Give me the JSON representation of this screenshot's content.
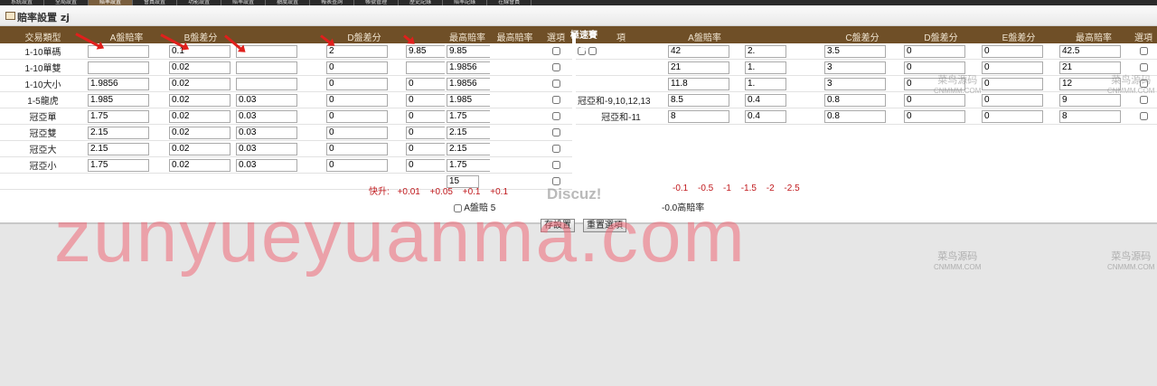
{
  "topnav": {
    "tabs": [
      "系統設置",
      "全局設置",
      "賠率設置",
      "會員設置",
      "功能設置",
      "賠率設置",
      "額度設置",
      "報表查詢",
      "帳號管理",
      "歷史記錄",
      "賠率記錄",
      "在線會員"
    ]
  },
  "panel": {
    "title": "賠率設置 zj",
    "right_section_title": "極速賽車"
  },
  "left_table": {
    "headers": [
      "交易類型",
      "A盤賠率",
      "B盤差分",
      "",
      "D盤差分",
      "",
      "最高賠率",
      "最高賠率",
      "選項"
    ],
    "rows": [
      {
        "label": "1-10單碼",
        "a": "",
        "b": "0.1",
        "c": "",
        "d": "2",
        "e": "9.85",
        "f": "9.85"
      },
      {
        "label": "1-10單雙",
        "a": "",
        "b": "0.02",
        "c": "",
        "d": "0",
        "e": "",
        "f": "1.9856"
      },
      {
        "label": "1-10大小",
        "a": "1.9856",
        "b": "0.02",
        "c": "",
        "d": "0",
        "e": "0",
        "f": "1.9856"
      },
      {
        "label": "1-5龍虎",
        "a": "1.985",
        "b": "0.02",
        "c": "0.03",
        "d": "0",
        "e": "0",
        "f": "1.985"
      },
      {
        "label": "冠亞單",
        "a": "1.75",
        "b": "0.02",
        "c": "0.03",
        "d": "0",
        "e": "0",
        "f": "1.75"
      },
      {
        "label": "冠亞雙",
        "a": "2.15",
        "b": "0.02",
        "c": "0.03",
        "d": "0",
        "e": "0",
        "f": "2.15"
      },
      {
        "label": "冠亞大",
        "a": "2.15",
        "b": "0.02",
        "c": "0.03",
        "d": "0",
        "e": "0",
        "f": "2.15"
      },
      {
        "label": "冠亞小",
        "a": "1.75",
        "b": "0.02",
        "c": "0.03",
        "d": "0",
        "e": "0",
        "f": "1.75"
      }
    ],
    "extra_value": "15"
  },
  "right_table": {
    "headers": [
      "項",
      "A盤賠率",
      "",
      "C盤差分",
      "D盤差分",
      "E盤差分",
      "最高賠率",
      "選項"
    ],
    "rows": [
      {
        "label": "",
        "a": "42",
        "b": "2.",
        "c": "3.5",
        "d": "0",
        "e": "0",
        "f": "42.5"
      },
      {
        "label": "",
        "a": "21",
        "b": "1.",
        "c": "3",
        "d": "0",
        "e": "0",
        "f": "21"
      },
      {
        "label": "",
        "a": "11.8",
        "b": "1.",
        "c": "3",
        "d": "0",
        "e": "0",
        "f": "12"
      },
      {
        "label": "冠亞和-9,10,12,13",
        "a": "8.5",
        "b": "0.4",
        "c": "0.8",
        "d": "0",
        "e": "0",
        "f": "9"
      },
      {
        "label": "冠亞和-11",
        "a": "8",
        "b": "0.4",
        "c": "0.8",
        "d": "0",
        "e": "0",
        "f": "8"
      }
    ]
  },
  "quick_adjust": {
    "label": "快升:",
    "up_values": [
      "+0.01",
      "+0.05",
      "+0.1",
      "+0.1"
    ],
    "down_values": [
      "-0.1",
      "-0.5",
      "-1",
      "-1.5",
      "-2",
      "-2.5"
    ]
  },
  "a_mode": {
    "label": "A盤賠",
    "value": "5"
  },
  "max_odds_label": "-0.0高賠率",
  "buttons": {
    "save": "存設置",
    "reset": "重置選項"
  },
  "watermark": {
    "main": "zunyueyuanma.com",
    "site": "菜鸟源码",
    "site_sub": "CNMMM.COM",
    "discuz": "Discuz!"
  },
  "accent_color": "#6f4f27",
  "arrow_color": "#e0201c"
}
